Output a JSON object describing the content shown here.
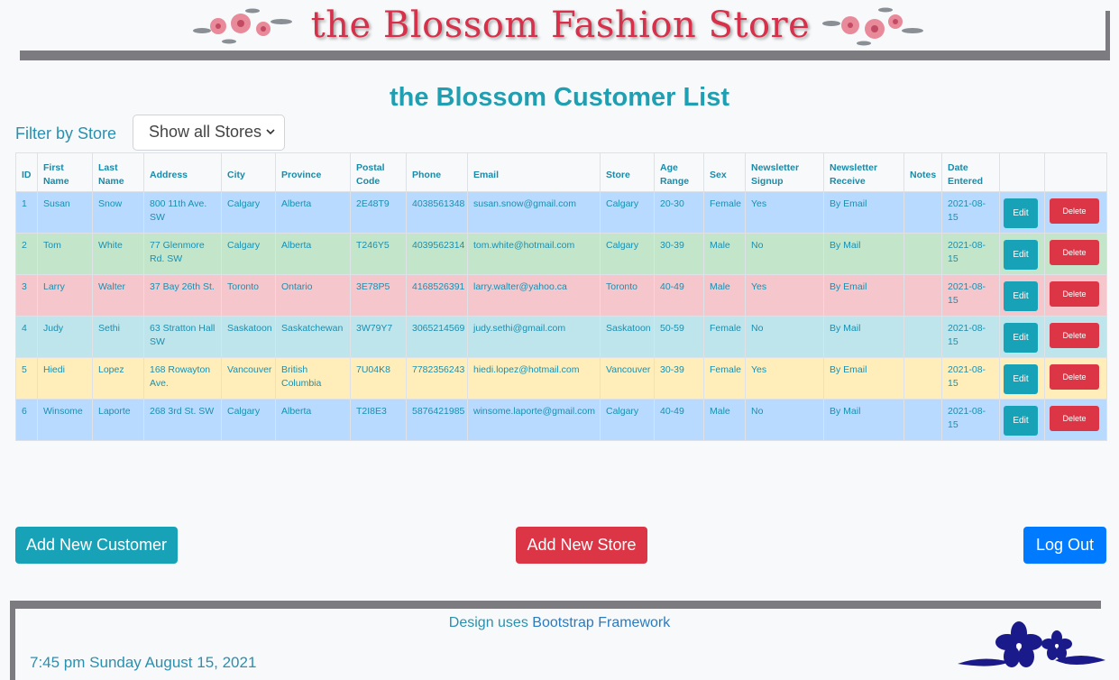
{
  "header": {
    "title": "the Blossom Fashion Store"
  },
  "page_title": "the Blossom Customer List",
  "filter": {
    "label": "Filter by Store",
    "selected": "Show all Stores"
  },
  "table": {
    "columns": [
      "ID",
      "First Name",
      "Last Name",
      "Address",
      "City",
      "Province",
      "Postal Code",
      "Phone",
      "Email",
      "Store",
      "Age Range",
      "Sex",
      "Newsletter Signup",
      "Newsletter Receive",
      "Notes",
      "Date Entered",
      "",
      ""
    ],
    "edit_label": "Edit",
    "delete_label": "Delete",
    "rows": [
      {
        "id": "1",
        "first": "Susan",
        "last": "Snow",
        "address": "800 11th Ave. SW",
        "city": "Calgary",
        "province": "Alberta",
        "postal": "2E48T9",
        "phone": "4038561348",
        "email": "susan.snow@gmail.com",
        "store": "Calgary",
        "age": "20-30",
        "sex": "Female",
        "signup": "Yes",
        "receive": "By Email",
        "notes": "",
        "date": "2021-08-15",
        "color": "#b8daff"
      },
      {
        "id": "2",
        "first": "Tom",
        "last": "White",
        "address": "77 Glenmore Rd. SW",
        "city": "Calgary",
        "province": "Alberta",
        "postal": "T246Y5",
        "phone": "4039562314",
        "email": "tom.white@hotmail.com",
        "store": "Calgary",
        "age": "30-39",
        "sex": "Male",
        "signup": "No",
        "receive": "By Mail",
        "notes": "",
        "date": "2021-08-15",
        "color": "#c3e6cb"
      },
      {
        "id": "3",
        "first": "Larry",
        "last": "Walter",
        "address": "37 Bay 26th St.",
        "city": "Toronto",
        "province": "Ontario",
        "postal": "3E78P5",
        "phone": "4168526391",
        "email": "larry.walter@yahoo.ca",
        "store": "Toronto",
        "age": "40-49",
        "sex": "Male",
        "signup": "Yes",
        "receive": "By Email",
        "notes": "",
        "date": "2021-08-15",
        "color": "#f5c6cb"
      },
      {
        "id": "4",
        "first": "Judy",
        "last": "Sethi",
        "address": "63 Stratton Hall SW",
        "city": "Saskatoon",
        "province": "Saskatchewan",
        "postal": "3W79Y7",
        "phone": "3065214569",
        "email": "judy.sethi@gmail.com",
        "store": "Saskatoon",
        "age": "50-59",
        "sex": "Female",
        "signup": "No",
        "receive": "By Mail",
        "notes": "",
        "date": "2021-08-15",
        "color": "#bee5eb"
      },
      {
        "id": "5",
        "first": "Hiedi",
        "last": "Lopez",
        "address": "168 Rowayton Ave.",
        "city": "Vancouver",
        "province": "British Columbia",
        "postal": "7U04K8",
        "phone": "7782356243",
        "email": "hiedi.lopez@hotmail.com",
        "store": "Vancouver",
        "age": "30-39",
        "sex": "Female",
        "signup": "Yes",
        "receive": "By Email",
        "notes": "",
        "date": "2021-08-15",
        "color": "#ffeeba"
      },
      {
        "id": "6",
        "first": "Winsome",
        "last": "Laporte",
        "address": "268 3rd St. SW",
        "city": "Calgary",
        "province": "Alberta",
        "postal": "T2I8E3",
        "phone": "5876421985",
        "email": "winsome.laporte@gmail.com",
        "store": "Calgary",
        "age": "40-49",
        "sex": "Male",
        "signup": "No",
        "receive": "By Mail",
        "notes": "",
        "date": "2021-08-15",
        "color": "#b8daff"
      }
    ]
  },
  "buttons": {
    "add_customer": "Add New Customer",
    "add_store": "Add New Store",
    "logout": "Log Out"
  },
  "footer": {
    "design_prefix": "Design uses ",
    "design_link": "Bootstrap Framework",
    "datetime": "7:45 pm Sunday August 15, 2021"
  },
  "colors": {
    "primary": "#17a2b8",
    "danger": "#dc3545",
    "blue": "#007bff",
    "title_red": "#d6304a"
  }
}
